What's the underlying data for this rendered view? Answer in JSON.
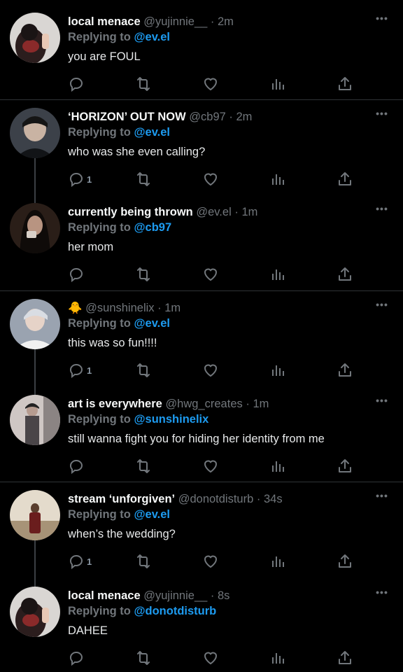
{
  "tweets": [
    {
      "name": "local menace",
      "handle": "@yujinnie__",
      "dot": "·",
      "time": "2m",
      "reply_prefix": "Replying to",
      "reply_to": "@ev.el",
      "text": "you are FOUL",
      "reply_count": ""
    },
    {
      "name": "‘HORIZON’ OUT NOW",
      "handle": "@cb97",
      "dot": "·",
      "time": "2m",
      "reply_prefix": "Replying to",
      "reply_to": "@ev.el",
      "text": "who was she even calling?",
      "reply_count": "1"
    },
    {
      "name": "currently being thrown",
      "handle": "@ev.el",
      "dot": "·",
      "time": "1m",
      "reply_prefix": "Replying to",
      "reply_to": "@cb97",
      "text": "her mom",
      "reply_count": ""
    },
    {
      "name": "🐥",
      "handle": "@sunshinelix",
      "dot": "·",
      "time": "1m",
      "reply_prefix": "Replying to",
      "reply_to": "@ev.el",
      "text": "this was so fun!!!!",
      "reply_count": "1"
    },
    {
      "name": "art is everywhere",
      "handle": "@hwg_creates",
      "dot": "·",
      "time": "1m",
      "reply_prefix": "Replying to",
      "reply_to": "@sunshinelix",
      "text": "still wanna fight you for hiding her identity from me",
      "reply_count": ""
    },
    {
      "name": "stream ‘unforgiven’",
      "handle": "@donotdisturb",
      "dot": "·",
      "time": "34s",
      "reply_prefix": "Replying to",
      "reply_to": "@ev.el",
      "text": "when’s the wedding?",
      "reply_count": "1"
    },
    {
      "name": "local menace",
      "handle": "@yujinnie__",
      "dot": "·",
      "time": "8s",
      "reply_prefix": "Replying to",
      "reply_to": "@donotdisturb",
      "text": "DAHEE",
      "reply_count": ""
    }
  ],
  "icons": {
    "reply": "reply-icon",
    "retweet": "retweet-icon",
    "like": "heart-icon",
    "views": "views-icon",
    "share": "share-icon",
    "more": "more-icon"
  },
  "colors": {
    "background": "#000000",
    "text": "#e7e9ea",
    "muted": "#71767b",
    "link": "#1d9bf0",
    "divider": "#2f3336"
  }
}
